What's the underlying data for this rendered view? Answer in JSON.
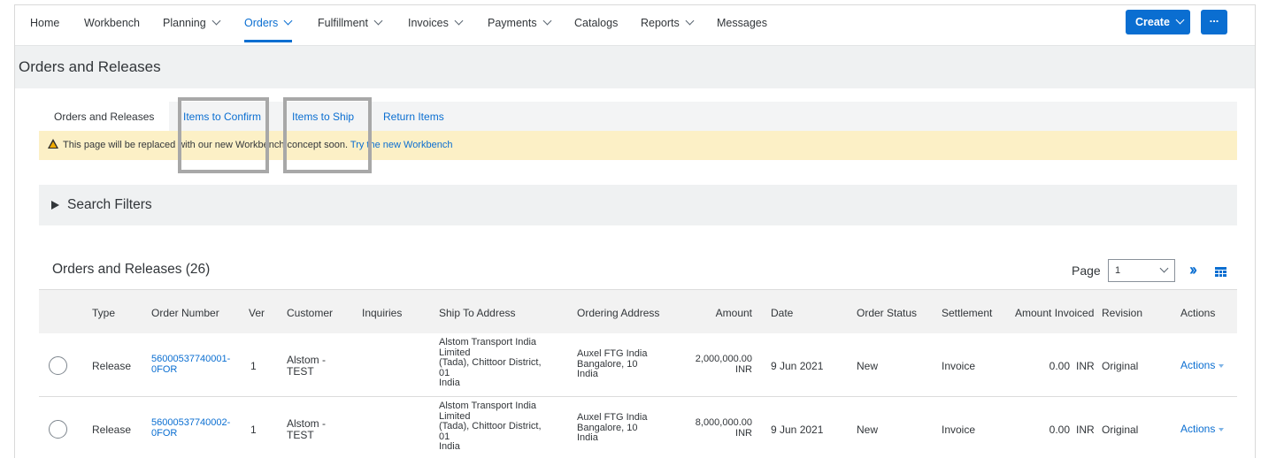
{
  "nav": {
    "items": [
      {
        "label": "Home",
        "dropdown": false
      },
      {
        "label": "Workbench",
        "dropdown": false
      },
      {
        "label": "Planning",
        "dropdown": true
      },
      {
        "label": "Orders",
        "dropdown": true,
        "active": true
      },
      {
        "label": "Fulfillment",
        "dropdown": true
      },
      {
        "label": "Invoices",
        "dropdown": true
      },
      {
        "label": "Payments",
        "dropdown": true
      },
      {
        "label": "Catalogs",
        "dropdown": false
      },
      {
        "label": "Reports",
        "dropdown": true
      },
      {
        "label": "Messages",
        "dropdown": false
      }
    ],
    "create_label": "Create",
    "more_label": "..."
  },
  "page": {
    "title": "Orders and Releases"
  },
  "tabs": [
    {
      "label": "Orders and Releases",
      "selected": true
    },
    {
      "label": "Items to Confirm"
    },
    {
      "label": "Items to Ship"
    },
    {
      "label": "Return Items"
    }
  ],
  "warning": {
    "text": "This page will be replaced with our new Workbench concept soon. ",
    "link": "Try the new Workbench"
  },
  "filters": {
    "label": "Search Filters"
  },
  "table": {
    "title": "Orders and Releases (26)",
    "page_label": "Page",
    "page_value": "1",
    "columns": [
      "Type",
      "Order Number",
      "Ver",
      "Customer",
      "Inquiries",
      "Ship To Address",
      "Ordering Address",
      "Amount",
      "Date",
      "Order Status",
      "Settlement",
      "Amount Invoiced",
      "Revision",
      "Actions"
    ],
    "rows": [
      {
        "type": "Release",
        "order_number_1": "56000537740001-",
        "order_number_2": "0FOR",
        "ver": "1",
        "customer_1": "Alstom -",
        "customer_2": "TEST",
        "inquiries": "",
        "ship_to": [
          "Alstom Transport India",
          "Limited",
          "(Tada), Chittoor District,",
          "01",
          "India"
        ],
        "ordering": [
          "Auxel FTG India",
          "Bangalore, 10",
          "India"
        ],
        "amount_1": "2,000,000.00",
        "amount_2": "INR",
        "date": "9 Jun 2021",
        "status": "New",
        "settlement": "Invoice",
        "amount_invoiced": "0.00",
        "amount_invoiced_currency": "INR",
        "revision": "Original",
        "actions": "Actions"
      },
      {
        "type": "Release",
        "order_number_1": "56000537740002-",
        "order_number_2": "0FOR",
        "ver": "1",
        "customer_1": "Alstom -",
        "customer_2": "TEST",
        "inquiries": "",
        "ship_to": [
          "Alstom Transport India",
          "Limited",
          "(Tada), Chittoor District,",
          "01",
          "India"
        ],
        "ordering": [
          "Auxel FTG India",
          "Bangalore, 10",
          "India"
        ],
        "amount_1": "8,000,000.00",
        "amount_2": "INR",
        "date": "9 Jun 2021",
        "status": "New",
        "settlement": "Invoice",
        "amount_invoiced": "0.00",
        "amount_invoiced_currency": "INR",
        "revision": "Original",
        "actions": "Actions"
      }
    ]
  },
  "colors": {
    "accent": "#0a6ed1",
    "warning_bg": "#fcf0c6",
    "header_bg": "#eff1f2"
  },
  "icons": [
    "chevron-down-icon",
    "warning-icon",
    "expand-triangle-icon",
    "next-page-icon",
    "table-settings-icon",
    "radio-button"
  ]
}
